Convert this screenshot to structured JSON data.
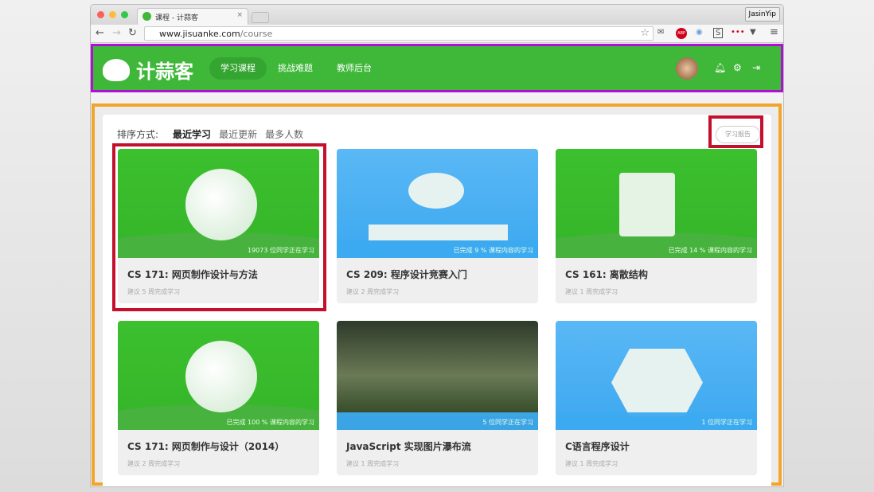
{
  "browser": {
    "tab_title": "课程 - 计蒜客",
    "user": "JasinYip",
    "url_domain": "www.jisuanke.com",
    "url_path": "/course"
  },
  "header": {
    "logo": "计蒜客",
    "nav": [
      "学习课程",
      "挑战难题",
      "教师后台"
    ]
  },
  "sort": {
    "label": "排序方式:",
    "options": [
      "最近学习",
      "最近更新",
      "最多人数"
    ]
  },
  "report_button": "学习报告",
  "courses": [
    {
      "title": "CS 171: 网页制作设计与方法",
      "stat": "19073 位同学正在学习",
      "sub": "建议 5 周完成学习"
    },
    {
      "title": "CS 209: 程序设计竞赛入门",
      "stat": "已完成 9 % 课程内容的学习",
      "sub": "建议 2 周完成学习"
    },
    {
      "title": "CS 161: 离散结构",
      "stat": "已完成 14 % 课程内容的学习",
      "sub": "建议 1 周完成学习"
    },
    {
      "title": "CS 171: 网页制作与设计（2014）",
      "stat": "已完成 100 % 课程内容的学习",
      "sub": "建议 2 周完成学习"
    },
    {
      "title": "JavaScript 实现图片瀑布流",
      "stat": "5 位同学正在学习",
      "sub": "建议 1 周完成学习"
    },
    {
      "title": "C语言程序设计",
      "stat": "1 位同学正在学习",
      "sub": "建议 1 周完成学习"
    }
  ]
}
